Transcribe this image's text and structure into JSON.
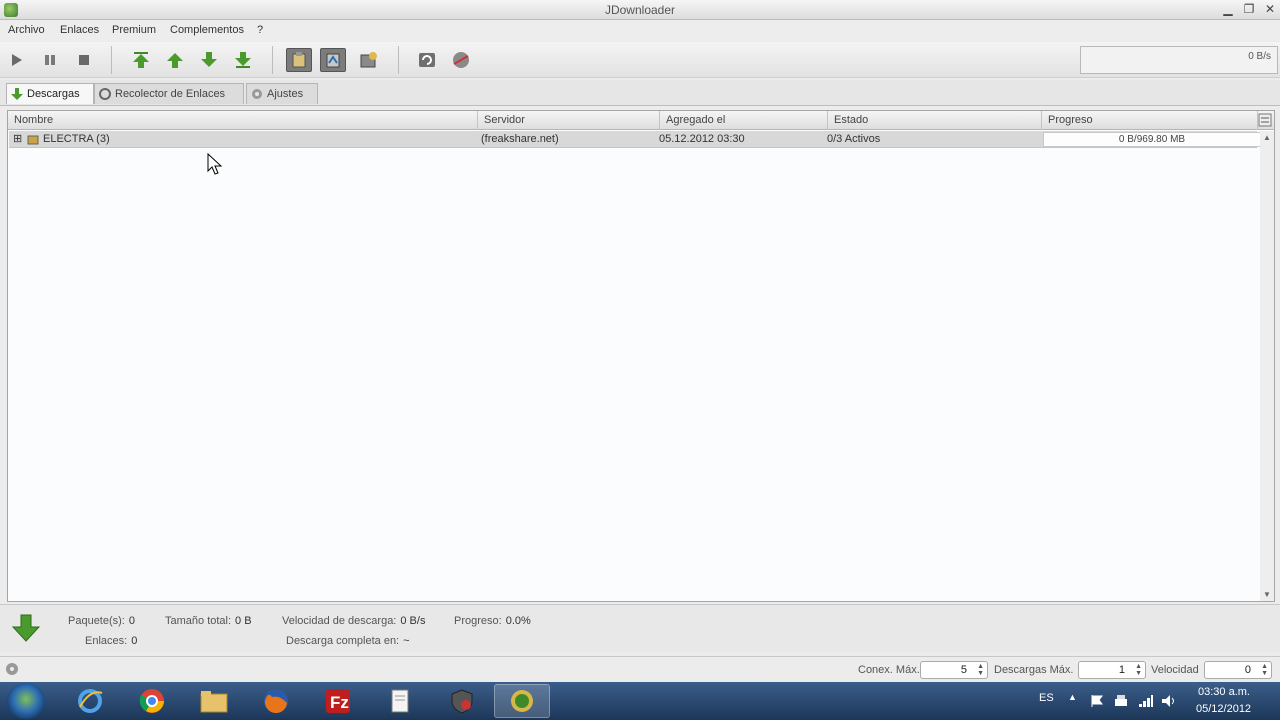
{
  "window": {
    "title": "JDownloader",
    "controls": {
      "minimize": "▁",
      "maximize": "❐",
      "close": "✕"
    }
  },
  "menu": [
    "Archivo",
    "Enlaces",
    "Premium",
    "Complementos",
    "?"
  ],
  "toolbar": {
    "icons": [
      "play-icon",
      "pause-icon",
      "stop-icon",
      "move-top-icon",
      "move-up-icon",
      "move-down-icon",
      "move-bottom-icon",
      "clipboard-icon",
      "reconnect-toggle-icon",
      "premium-toggle-icon",
      "refresh-icon",
      "reconnect-icon"
    ],
    "speed_readout": "0 B/s"
  },
  "tabs": [
    {
      "label": "Descargas",
      "icon": "download-arrow-icon",
      "active": true
    },
    {
      "label": "Recolector de Enlaces",
      "icon": "link-grabber-icon",
      "active": false
    },
    {
      "label": "Ajustes",
      "icon": "gear-icon",
      "active": false
    }
  ],
  "table": {
    "columns": [
      "Nombre",
      "Servidor",
      "Agregado el",
      "Estado",
      "Progreso"
    ],
    "rows": [
      {
        "name": "ELECTRA (3)",
        "host": "(freakshare.net)",
        "added": "05.12.2012 03:30",
        "status": "0/3 Activos",
        "progress": "0 B/969.80 MB"
      }
    ]
  },
  "status": {
    "packages_label": "Paquete(s):",
    "packages_value": "0",
    "links_label": "Enlaces:",
    "links_value": "0",
    "total_size_label": "Tamaño total:",
    "total_size_value": "0 B",
    "speed_label": "Velocidad de descarga:",
    "speed_value": "0 B/s",
    "progress_label": "Progreso:",
    "progress_value": "0.0%",
    "eta_label": "Descarga completa en:",
    "eta_value": "~"
  },
  "controls": {
    "max_conn_label": "Conex. Máx.",
    "max_conn_value": "5",
    "max_dl_label": "Descargas Máx.",
    "max_dl_value": "1",
    "speed_label": "Velocidad",
    "speed_value": "0"
  },
  "taskbar": {
    "apps": [
      "ie-icon",
      "chrome-icon",
      "folder-icon",
      "firefox-icon",
      "filezilla-icon",
      "notepad-icon",
      "security-icon",
      "jdownloader-icon"
    ],
    "language": "ES",
    "time": "03:30 a.m.",
    "date": "05/12/2012"
  },
  "colors": {
    "download_green": "#4a9a2e",
    "taskbar": "#1c3658",
    "row_bg": "#d8d8d8"
  }
}
